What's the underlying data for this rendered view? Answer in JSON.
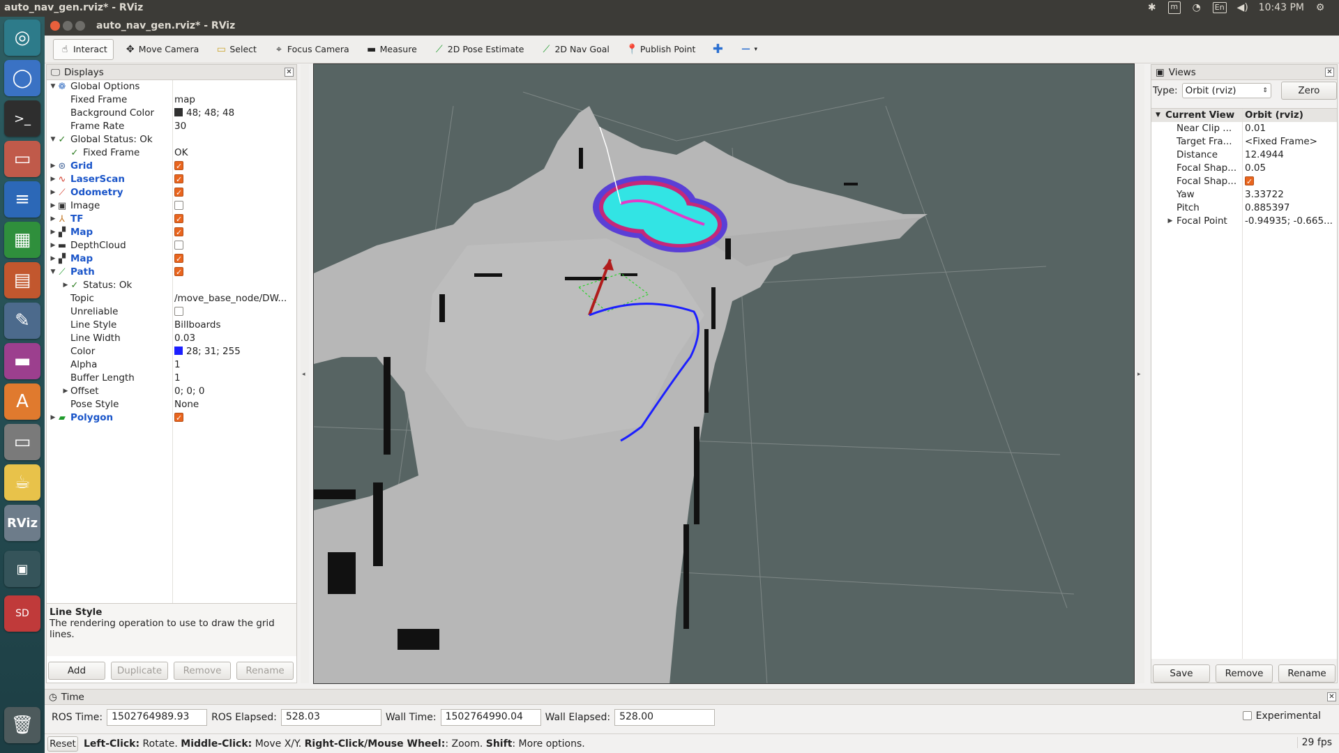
{
  "system": {
    "window_title": "auto_nav_gen.rviz* - RViz",
    "keyboard": "En",
    "clock": "10:43 PM"
  },
  "window": {
    "title": "auto_nav_gen.rviz* - RViz"
  },
  "toolbar": {
    "tools": [
      {
        "label": "Interact",
        "icon": "cursor-icon",
        "active": true
      },
      {
        "label": "Move Camera",
        "icon": "move-camera-icon"
      },
      {
        "label": "Select",
        "icon": "select-box-icon"
      },
      {
        "label": "Focus Camera",
        "icon": "focus-icon"
      },
      {
        "label": "Measure",
        "icon": "ruler-icon"
      },
      {
        "label": "2D Pose Estimate",
        "icon": "green-arrow-icon"
      },
      {
        "label": "2D Nav Goal",
        "icon": "green-arrow-icon"
      },
      {
        "label": "Publish Point",
        "icon": "red-pin-icon"
      }
    ]
  },
  "displays": {
    "title": "Displays",
    "rows": [
      {
        "label": "Global Options",
        "value": ""
      },
      {
        "label": "Fixed Frame",
        "value": "map"
      },
      {
        "label": "Background Color",
        "value": "48; 48; 48",
        "swatch": "#303030"
      },
      {
        "label": "Frame Rate",
        "value": "30"
      },
      {
        "label": "Global Status: Ok",
        "value": ""
      },
      {
        "label": "Fixed Frame",
        "value": "OK"
      },
      {
        "label": "Grid",
        "checked": true
      },
      {
        "label": "LaserScan",
        "checked": true
      },
      {
        "label": "Odometry",
        "checked": true
      },
      {
        "label": "Image",
        "checked": false
      },
      {
        "label": "TF",
        "checked": true
      },
      {
        "label": "Map",
        "checked": true
      },
      {
        "label": "DepthCloud",
        "checked": false
      },
      {
        "label": "Map",
        "checked": true
      },
      {
        "label": "Path",
        "checked": true
      },
      {
        "label": "Status: Ok",
        "value": ""
      },
      {
        "label": "Topic",
        "value": "/move_base_node/DW..."
      },
      {
        "label": "Unreliable",
        "checked": false
      },
      {
        "label": "Line Style",
        "value": "Billboards"
      },
      {
        "label": "Line Width",
        "value": "0.03"
      },
      {
        "label": "Color",
        "value": "28; 31; 255",
        "swatch": "#1c1fff"
      },
      {
        "label": "Alpha",
        "value": "1"
      },
      {
        "label": "Buffer Length",
        "value": "1"
      },
      {
        "label": "Offset",
        "value": "0; 0; 0"
      },
      {
        "label": "Pose Style",
        "value": "None"
      },
      {
        "label": "Polygon",
        "checked": true
      }
    ],
    "description_title": "Line Style",
    "description_text": "The rendering operation to use to draw the grid lines.",
    "buttons": [
      "Add",
      "Duplicate",
      "Remove",
      "Rename"
    ]
  },
  "views": {
    "title": "Views",
    "type_label": "Type:",
    "type_value": "Orbit (rviz)",
    "zero_label": "Zero",
    "header_left": "Current View",
    "header_right": "Orbit (rviz)",
    "rows": [
      {
        "label": "Near Clip ...",
        "value": "0.01"
      },
      {
        "label": "Target Fra...",
        "value": "<Fixed Frame>"
      },
      {
        "label": "Distance",
        "value": "12.4944"
      },
      {
        "label": "Focal Shap...",
        "value": "0.05"
      },
      {
        "label": "Focal Shap...",
        "value": ""
      },
      {
        "label": "Yaw",
        "value": "3.33722"
      },
      {
        "label": "Pitch",
        "value": "0.885397"
      },
      {
        "label": "Focal Point",
        "value": "-0.94935; -0.665..."
      }
    ],
    "buttons": [
      "Save",
      "Remove",
      "Rename"
    ]
  },
  "time": {
    "title": "Time",
    "ros_time_label": "ROS Time:",
    "ros_time": "1502764989.93",
    "ros_elapsed_label": "ROS Elapsed:",
    "ros_elapsed": "528.03",
    "wall_time_label": "Wall Time:",
    "wall_time": "1502764990.04",
    "wall_elapsed_label": "Wall Elapsed:",
    "wall_elapsed": "528.00",
    "experimental_label": "Experimental"
  },
  "status": {
    "reset": "Reset",
    "k1": "Left-Click:",
    "v1": " Rotate. ",
    "k2": "Middle-Click:",
    "v2": " Move X/Y. ",
    "k3": "Right-Click/Mouse Wheel:",
    "v3": ": Zoom. ",
    "k4": "Shift",
    "v4": ": More options.",
    "fps": "29 fps"
  }
}
